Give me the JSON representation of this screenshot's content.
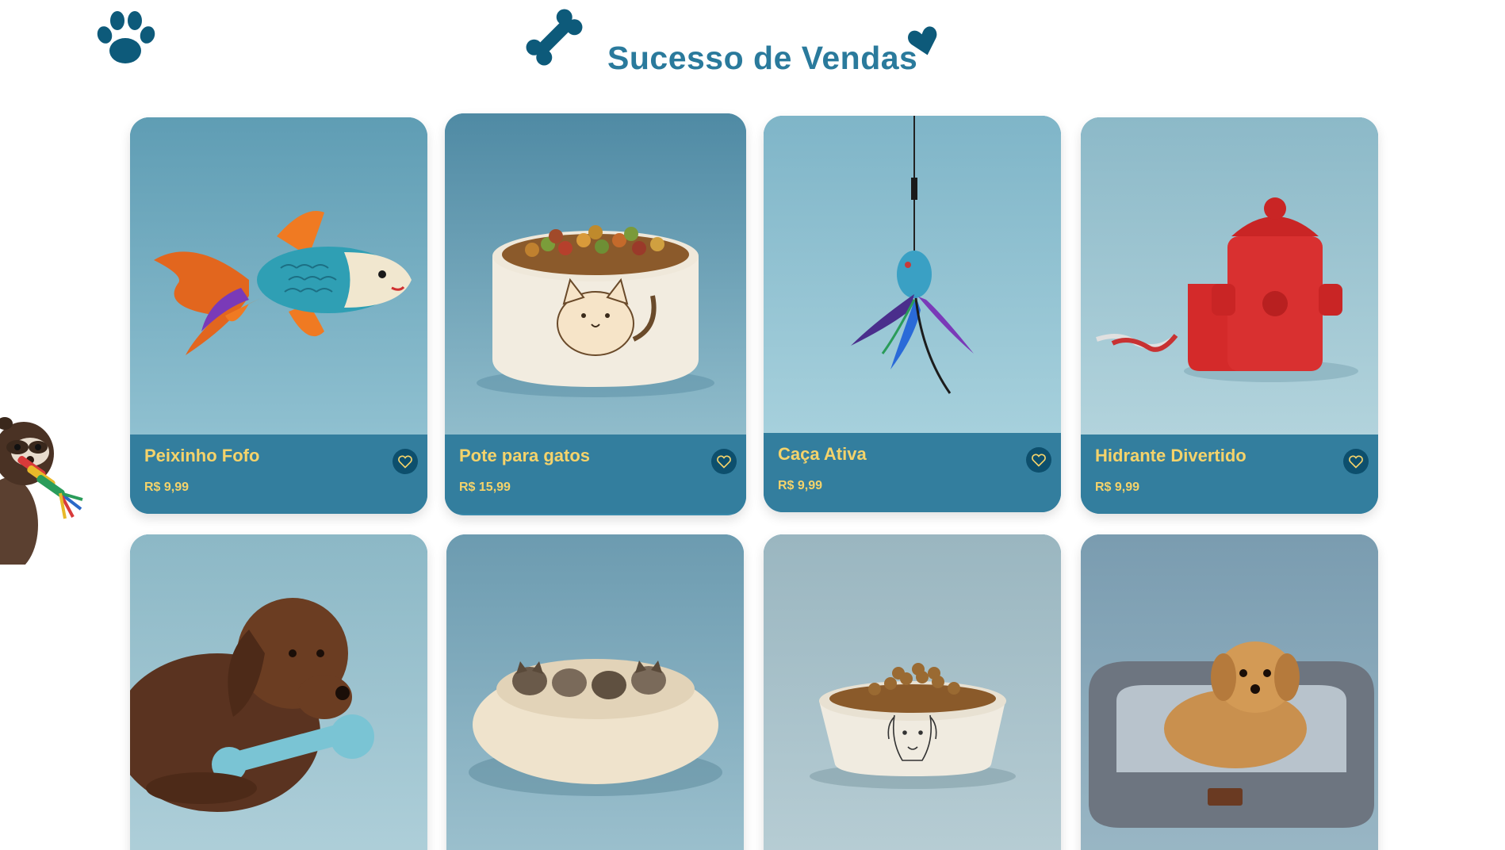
{
  "section": {
    "title": "Sucesso de Vendas"
  },
  "icons": {
    "paw": "paw-icon",
    "bone": "bone-icon",
    "heart": "heart-icon",
    "favorite": "heart-outline-icon"
  },
  "colors": {
    "title": "#2a7a9c",
    "card_footer": "#337e9e",
    "text_accent": "#f4d36b",
    "icon_dark": "#0d5a7a"
  },
  "products": [
    {
      "name": "Peixinho Fofo",
      "price": "R$ 9,99"
    },
    {
      "name": "Pote para gatos",
      "price": "R$ 15,99"
    },
    {
      "name": "Caça Ativa",
      "price": "R$ 9,99"
    },
    {
      "name": "Hidrante Divertido",
      "price": "R$ 9,99"
    }
  ]
}
